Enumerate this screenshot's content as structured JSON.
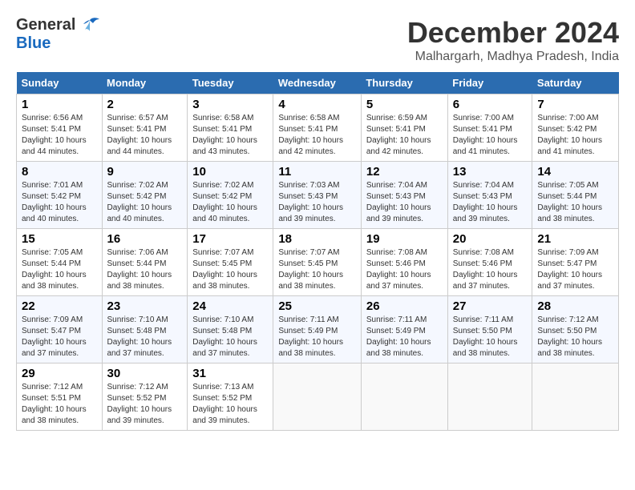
{
  "header": {
    "logo": {
      "general": "General",
      "blue": "Blue"
    },
    "month": "December 2024",
    "location": "Malhargarh, Madhya Pradesh, India"
  },
  "columns": [
    "Sunday",
    "Monday",
    "Tuesday",
    "Wednesday",
    "Thursday",
    "Friday",
    "Saturday"
  ],
  "weeks": [
    [
      {
        "day": "1",
        "sunrise": "Sunrise: 6:56 AM",
        "sunset": "Sunset: 5:41 PM",
        "daylight": "Daylight: 10 hours and 44 minutes."
      },
      {
        "day": "2",
        "sunrise": "Sunrise: 6:57 AM",
        "sunset": "Sunset: 5:41 PM",
        "daylight": "Daylight: 10 hours and 44 minutes."
      },
      {
        "day": "3",
        "sunrise": "Sunrise: 6:58 AM",
        "sunset": "Sunset: 5:41 PM",
        "daylight": "Daylight: 10 hours and 43 minutes."
      },
      {
        "day": "4",
        "sunrise": "Sunrise: 6:58 AM",
        "sunset": "Sunset: 5:41 PM",
        "daylight": "Daylight: 10 hours and 42 minutes."
      },
      {
        "day": "5",
        "sunrise": "Sunrise: 6:59 AM",
        "sunset": "Sunset: 5:41 PM",
        "daylight": "Daylight: 10 hours and 42 minutes."
      },
      {
        "day": "6",
        "sunrise": "Sunrise: 7:00 AM",
        "sunset": "Sunset: 5:41 PM",
        "daylight": "Daylight: 10 hours and 41 minutes."
      },
      {
        "day": "7",
        "sunrise": "Sunrise: 7:00 AM",
        "sunset": "Sunset: 5:42 PM",
        "daylight": "Daylight: 10 hours and 41 minutes."
      }
    ],
    [
      {
        "day": "8",
        "sunrise": "Sunrise: 7:01 AM",
        "sunset": "Sunset: 5:42 PM",
        "daylight": "Daylight: 10 hours and 40 minutes."
      },
      {
        "day": "9",
        "sunrise": "Sunrise: 7:02 AM",
        "sunset": "Sunset: 5:42 PM",
        "daylight": "Daylight: 10 hours and 40 minutes."
      },
      {
        "day": "10",
        "sunrise": "Sunrise: 7:02 AM",
        "sunset": "Sunset: 5:42 PM",
        "daylight": "Daylight: 10 hours and 40 minutes."
      },
      {
        "day": "11",
        "sunrise": "Sunrise: 7:03 AM",
        "sunset": "Sunset: 5:43 PM",
        "daylight": "Daylight: 10 hours and 39 minutes."
      },
      {
        "day": "12",
        "sunrise": "Sunrise: 7:04 AM",
        "sunset": "Sunset: 5:43 PM",
        "daylight": "Daylight: 10 hours and 39 minutes."
      },
      {
        "day": "13",
        "sunrise": "Sunrise: 7:04 AM",
        "sunset": "Sunset: 5:43 PM",
        "daylight": "Daylight: 10 hours and 39 minutes."
      },
      {
        "day": "14",
        "sunrise": "Sunrise: 7:05 AM",
        "sunset": "Sunset: 5:44 PM",
        "daylight": "Daylight: 10 hours and 38 minutes."
      }
    ],
    [
      {
        "day": "15",
        "sunrise": "Sunrise: 7:05 AM",
        "sunset": "Sunset: 5:44 PM",
        "daylight": "Daylight: 10 hours and 38 minutes."
      },
      {
        "day": "16",
        "sunrise": "Sunrise: 7:06 AM",
        "sunset": "Sunset: 5:44 PM",
        "daylight": "Daylight: 10 hours and 38 minutes."
      },
      {
        "day": "17",
        "sunrise": "Sunrise: 7:07 AM",
        "sunset": "Sunset: 5:45 PM",
        "daylight": "Daylight: 10 hours and 38 minutes."
      },
      {
        "day": "18",
        "sunrise": "Sunrise: 7:07 AM",
        "sunset": "Sunset: 5:45 PM",
        "daylight": "Daylight: 10 hours and 38 minutes."
      },
      {
        "day": "19",
        "sunrise": "Sunrise: 7:08 AM",
        "sunset": "Sunset: 5:46 PM",
        "daylight": "Daylight: 10 hours and 37 minutes."
      },
      {
        "day": "20",
        "sunrise": "Sunrise: 7:08 AM",
        "sunset": "Sunset: 5:46 PM",
        "daylight": "Daylight: 10 hours and 37 minutes."
      },
      {
        "day": "21",
        "sunrise": "Sunrise: 7:09 AM",
        "sunset": "Sunset: 5:47 PM",
        "daylight": "Daylight: 10 hours and 37 minutes."
      }
    ],
    [
      {
        "day": "22",
        "sunrise": "Sunrise: 7:09 AM",
        "sunset": "Sunset: 5:47 PM",
        "daylight": "Daylight: 10 hours and 37 minutes."
      },
      {
        "day": "23",
        "sunrise": "Sunrise: 7:10 AM",
        "sunset": "Sunset: 5:48 PM",
        "daylight": "Daylight: 10 hours and 37 minutes."
      },
      {
        "day": "24",
        "sunrise": "Sunrise: 7:10 AM",
        "sunset": "Sunset: 5:48 PM",
        "daylight": "Daylight: 10 hours and 37 minutes."
      },
      {
        "day": "25",
        "sunrise": "Sunrise: 7:11 AM",
        "sunset": "Sunset: 5:49 PM",
        "daylight": "Daylight: 10 hours and 38 minutes."
      },
      {
        "day": "26",
        "sunrise": "Sunrise: 7:11 AM",
        "sunset": "Sunset: 5:49 PM",
        "daylight": "Daylight: 10 hours and 38 minutes."
      },
      {
        "day": "27",
        "sunrise": "Sunrise: 7:11 AM",
        "sunset": "Sunset: 5:50 PM",
        "daylight": "Daylight: 10 hours and 38 minutes."
      },
      {
        "day": "28",
        "sunrise": "Sunrise: 7:12 AM",
        "sunset": "Sunset: 5:50 PM",
        "daylight": "Daylight: 10 hours and 38 minutes."
      }
    ],
    [
      {
        "day": "29",
        "sunrise": "Sunrise: 7:12 AM",
        "sunset": "Sunset: 5:51 PM",
        "daylight": "Daylight: 10 hours and 38 minutes."
      },
      {
        "day": "30",
        "sunrise": "Sunrise: 7:12 AM",
        "sunset": "Sunset: 5:52 PM",
        "daylight": "Daylight: 10 hours and 39 minutes."
      },
      {
        "day": "31",
        "sunrise": "Sunrise: 7:13 AM",
        "sunset": "Sunset: 5:52 PM",
        "daylight": "Daylight: 10 hours and 39 minutes."
      },
      null,
      null,
      null,
      null
    ]
  ]
}
